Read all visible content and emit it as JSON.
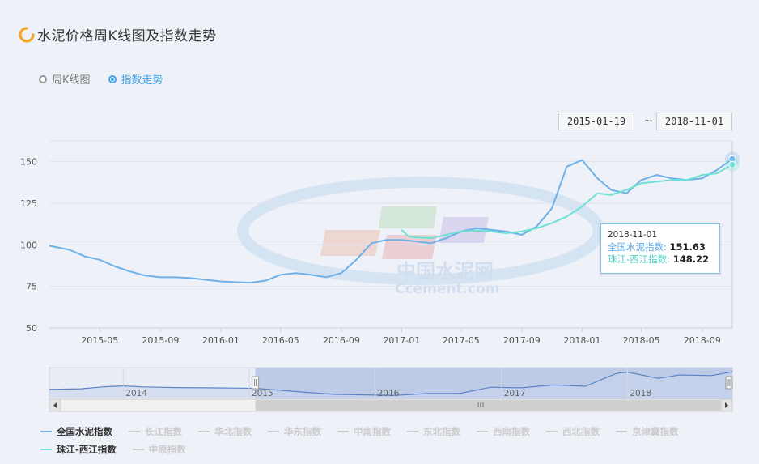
{
  "title": "水泥价格周K线图及指数走势",
  "radios": [
    {
      "label": "周K线图",
      "active": false
    },
    {
      "label": "指数走势",
      "active": true
    }
  ],
  "range": {
    "start": "2015-01-19",
    "separator": "~",
    "end": "2018-11-01"
  },
  "watermark": {
    "cn": "中国水泥网",
    "en": "Ccement.com"
  },
  "tooltip": {
    "date": "2018-11-01",
    "rows": [
      {
        "label": "全国水泥指数",
        "value": "151.63"
      },
      {
        "label": "珠江-西江指数",
        "value": "148.22"
      }
    ]
  },
  "legend": {
    "row1": [
      {
        "label": "全国水泥指数",
        "on": true,
        "color": "#6eb0e8"
      },
      {
        "label": "长江指数",
        "on": false
      },
      {
        "label": "华北指数",
        "on": false
      },
      {
        "label": "华东指数",
        "on": false
      },
      {
        "label": "中南指数",
        "on": false
      },
      {
        "label": "东北指数",
        "on": false
      },
      {
        "label": "西南指数",
        "on": false
      },
      {
        "label": "西北指数",
        "on": false
      },
      {
        "label": "京津冀指数",
        "on": false
      }
    ],
    "row2": [
      {
        "label": "珠江-西江指数",
        "on": true,
        "color": "#6fe0d4"
      },
      {
        "label": "中原指数",
        "on": false
      }
    ]
  },
  "colors": {
    "national": "#6eb0e8",
    "zhujiang": "#6fe0d4",
    "zoomFill": "#b6c4e4"
  },
  "chart_data": {
    "type": "line",
    "x_type": "date",
    "x_range": [
      "2015-01-19",
      "2018-11-01"
    ],
    "ylim": [
      50,
      150
    ],
    "y_ticks": [
      50,
      75,
      100,
      125,
      150
    ],
    "x_ticks": [
      "2015-05",
      "2015-09",
      "2016-01",
      "2016-05",
      "2016-09",
      "2017-01",
      "2017-05",
      "2017-09",
      "2018-01",
      "2018-05",
      "2018-09"
    ],
    "grid": true,
    "legend_position": "bottom",
    "series": [
      {
        "name": "全国水泥指数",
        "points": [
          [
            "2015-01-19",
            99.5
          ],
          [
            "2015-03-01",
            97
          ],
          [
            "2015-04-01",
            93
          ],
          [
            "2015-05-01",
            91
          ],
          [
            "2015-06-01",
            87
          ],
          [
            "2015-07-01",
            84
          ],
          [
            "2015-08-01",
            81.5
          ],
          [
            "2015-09-01",
            80.5
          ],
          [
            "2015-10-01",
            80.5
          ],
          [
            "2015-11-01",
            80
          ],
          [
            "2015-12-01",
            79
          ],
          [
            "2016-01-01",
            78
          ],
          [
            "2016-02-01",
            77.5
          ],
          [
            "2016-03-01",
            77.2
          ],
          [
            "2016-04-01",
            78.5
          ],
          [
            "2016-05-01",
            82
          ],
          [
            "2016-06-01",
            83
          ],
          [
            "2016-07-01",
            82
          ],
          [
            "2016-08-01",
            80.5
          ],
          [
            "2016-09-01",
            83
          ],
          [
            "2016-10-01",
            91
          ],
          [
            "2016-11-01",
            101
          ],
          [
            "2016-12-01",
            103
          ],
          [
            "2017-01-01",
            103
          ],
          [
            "2017-02-01",
            102
          ],
          [
            "2017-03-01",
            101
          ],
          [
            "2017-04-01",
            104
          ],
          [
            "2017-05-01",
            108
          ],
          [
            "2017-06-01",
            110
          ],
          [
            "2017-07-01",
            109
          ],
          [
            "2017-08-01",
            108
          ],
          [
            "2017-09-01",
            106
          ],
          [
            "2017-10-01",
            111
          ],
          [
            "2017-11-01",
            122
          ],
          [
            "2017-12-01",
            147
          ],
          [
            "2018-01-01",
            151
          ],
          [
            "2018-02-01",
            140
          ],
          [
            "2018-03-01",
            133
          ],
          [
            "2018-04-01",
            131
          ],
          [
            "2018-05-01",
            139
          ],
          [
            "2018-06-01",
            142
          ],
          [
            "2018-07-01",
            140
          ],
          [
            "2018-08-01",
            139
          ],
          [
            "2018-09-01",
            140
          ],
          [
            "2018-10-01",
            145
          ],
          [
            "2018-11-01",
            151.63
          ]
        ]
      },
      {
        "name": "珠江-西江指数",
        "points": [
          [
            "2017-01-01",
            109
          ],
          [
            "2017-01-15",
            105
          ],
          [
            "2017-02-01",
            104.5
          ],
          [
            "2017-03-01",
            104
          ],
          [
            "2017-04-01",
            106
          ],
          [
            "2017-05-01",
            108
          ],
          [
            "2017-06-01",
            108.5
          ],
          [
            "2017-07-01",
            108
          ],
          [
            "2017-08-01",
            107
          ],
          [
            "2017-09-01",
            108
          ],
          [
            "2017-10-01",
            110
          ],
          [
            "2017-11-01",
            113
          ],
          [
            "2017-12-01",
            117
          ],
          [
            "2018-01-01",
            123
          ],
          [
            "2018-02-01",
            131
          ],
          [
            "2018-03-01",
            130
          ],
          [
            "2018-04-01",
            133
          ],
          [
            "2018-05-01",
            137
          ],
          [
            "2018-06-01",
            138
          ],
          [
            "2018-07-01",
            139
          ],
          [
            "2018-08-01",
            139
          ],
          [
            "2018-09-01",
            142
          ],
          [
            "2018-10-01",
            143
          ],
          [
            "2018-11-01",
            148.22
          ]
        ]
      }
    ],
    "navigator": {
      "range": [
        "2013-06-01",
        "2018-11-01"
      ],
      "selected": [
        "2015-01-19",
        "2018-11-01"
      ],
      "labels": [
        "2014",
        "2015",
        "2016",
        "2017",
        "2018"
      ],
      "points": [
        [
          "2013-06-01",
          96
        ],
        [
          "2013-09-01",
          98
        ],
        [
          "2013-11-01",
          104
        ],
        [
          "2014-01-01",
          107
        ],
        [
          "2014-03-01",
          104
        ],
        [
          "2014-06-01",
          102
        ],
        [
          "2014-09-01",
          101
        ],
        [
          "2014-12-01",
          100
        ],
        [
          "2015-01-19",
          99.5
        ],
        [
          "2015-06-01",
          88
        ],
        [
          "2015-09-01",
          80.5
        ],
        [
          "2016-01-01",
          78
        ],
        [
          "2016-03-01",
          77.2
        ],
        [
          "2016-06-01",
          83
        ],
        [
          "2016-09-01",
          83
        ],
        [
          "2016-12-01",
          103
        ],
        [
          "2017-03-01",
          101
        ],
        [
          "2017-06-01",
          110
        ],
        [
          "2017-09-01",
          106
        ],
        [
          "2017-12-01",
          147
        ],
        [
          "2018-01-01",
          151
        ],
        [
          "2018-04-01",
          131
        ],
        [
          "2018-06-01",
          142
        ],
        [
          "2018-09-01",
          140
        ],
        [
          "2018-11-01",
          151.63
        ]
      ]
    }
  }
}
